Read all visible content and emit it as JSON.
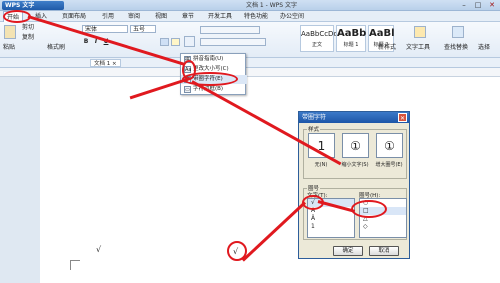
{
  "titlebar": {
    "app_name": "WPS 文字",
    "doc_title": "文档 1 - WPS 文字",
    "min": "–",
    "max": "□",
    "close": "✕"
  },
  "menu": [
    "开始",
    "插入",
    "页面布局",
    "引用",
    "审阅",
    "视图",
    "章节",
    "开发工具",
    "特色功能",
    "办公空间"
  ],
  "ribbon": {
    "paste": "粘贴",
    "cut": "剪切",
    "copy": "复制",
    "format_painter": "格式刷",
    "font_name": "宋体",
    "font_size": "五号",
    "bold": "B",
    "italic": "I",
    "underline": "U",
    "styles": [
      {
        "sample": "AaBbCcDd",
        "label": "正文"
      },
      {
        "sample": "AaBb",
        "label": "标题 1"
      },
      {
        "sample": "AaBl",
        "label": "标题 2"
      }
    ],
    "new_style": "新样式",
    "text_tools": "文字工具",
    "find_replace": "查找替换",
    "select": "选择"
  },
  "tabbar": {
    "doc_tab": "文档 1 ×"
  },
  "context_menu": {
    "items": [
      {
        "icon": "拼",
        "label": "拼音指南(U)"
      },
      {
        "icon": "Aa",
        "label": "更改大小写(C)"
      },
      {
        "icon": "字",
        "label": "带圈字符(E)"
      },
      {
        "icon": "▭",
        "label": "字符边框(B)"
      }
    ]
  },
  "dialog": {
    "title": "带圈字符",
    "style_label": "样式",
    "style_options": [
      {
        "glyph": "1",
        "label": "无(N)"
      },
      {
        "glyph": "①",
        "label": "缩小文字(S)"
      },
      {
        "glyph": "①",
        "label": "增大圈号(E)"
      }
    ],
    "circle_label": "圈号",
    "text_label": "文字(T):",
    "symbol_label": "圈号(H):",
    "text_items": [
      "√",
      "A",
      "Ä",
      "1",
      "2",
      "3"
    ],
    "symbol_items": [
      "○",
      "□",
      "△",
      "◇"
    ],
    "ok": "确定",
    "cancel": "取消"
  },
  "document": {
    "checkmark": "√",
    "circled_checkmark": "√"
  },
  "annotation_color": "#e0191f"
}
